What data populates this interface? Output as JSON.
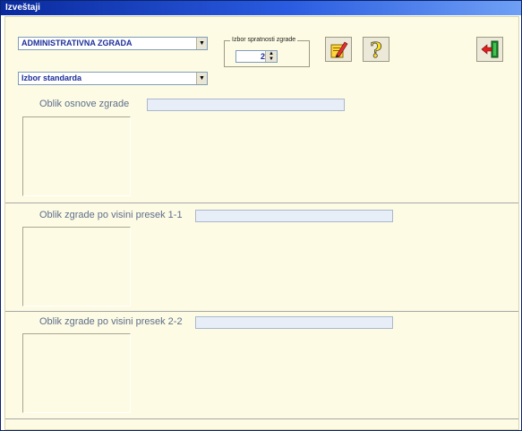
{
  "window": {
    "title": "Izveštaji"
  },
  "toolbar": {
    "building_type": "ADMINISTRATIVNA ZGRADA",
    "standard": "Izbor standarda",
    "floors_group_label": "Izbor spratnosti zgrade",
    "floors_value": "2"
  },
  "sections": [
    {
      "label": "Oblik osnove zgrade"
    },
    {
      "label": "Oblik zgrade po visini presek 1-1"
    },
    {
      "label": "Oblik zgrade po visini presek 2-2"
    }
  ]
}
